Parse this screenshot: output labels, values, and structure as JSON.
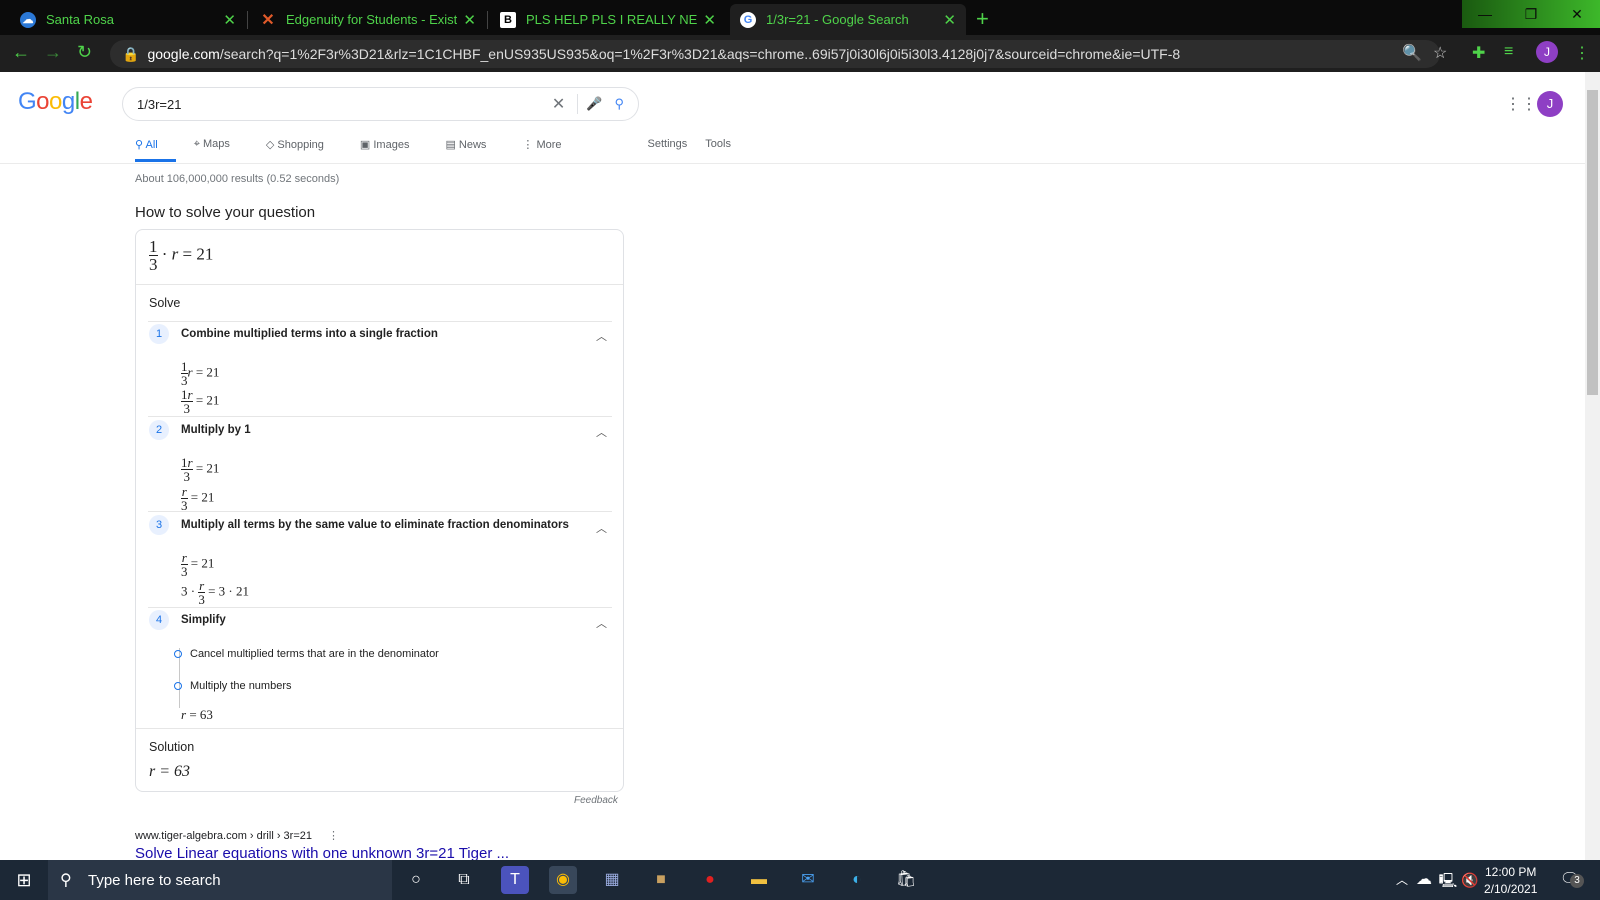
{
  "browser": {
    "tabs": [
      {
        "title": "Santa Rosa",
        "icon": "edge-cloud-icon"
      },
      {
        "title": "Edgenuity for Students - Existing",
        "icon": "edgenuity-icon"
      },
      {
        "title": "PLS HELP PLS I REALLY NEED IT!!",
        "icon": "brainly-icon"
      },
      {
        "title": "1/3r=21 - Google Search",
        "icon": "google-icon",
        "active": true
      }
    ],
    "url_domain": "google.com",
    "url_path": "/search?q=1%2F3r%3D21&rlz=1C1CHBF_enUS935US935&oq=1%2F3r%3D21&aqs=chrome..69i57j0i30l6j0i5i30l3.4128j0j7&sourceid=chrome&ie=UTF-8",
    "profile_initial": "J",
    "accent": "#4fd34a"
  },
  "google": {
    "logo": "Google",
    "query": "1/3r=21",
    "tabs": [
      "All",
      "Maps",
      "Shopping",
      "Images",
      "News",
      "More"
    ],
    "settings": "Settings",
    "tools": "Tools",
    "stats": "About 106,000,000 results (0.52 seconds)",
    "profile_initial": "J"
  },
  "solver": {
    "heading": "How to solve your question",
    "solve_label": "Solve",
    "steps": [
      {
        "n": "1",
        "title": "Combine multiplied terms into a single fraction"
      },
      {
        "n": "2",
        "title": "Multiply by 1"
      },
      {
        "n": "3",
        "title": "Multiply all terms by the same value to eliminate fraction denominators"
      },
      {
        "n": "4",
        "title": "Simplify",
        "substeps": [
          "Cancel multiplied terms that are in the denominator",
          "Multiply the numbers"
        ]
      }
    ],
    "solution_label": "Solution",
    "solution": "r = 63",
    "feedback": "Feedback"
  },
  "result": {
    "breadcrumb": "www.tiger-algebra.com › drill › 3r=21",
    "title": "Solve Linear equations with one unknown 3r=21 Tiger ..."
  },
  "taskbar": {
    "search_placeholder": "Type here to search",
    "time": "12:00 PM",
    "date": "2/10/2021",
    "notifications": "3"
  }
}
